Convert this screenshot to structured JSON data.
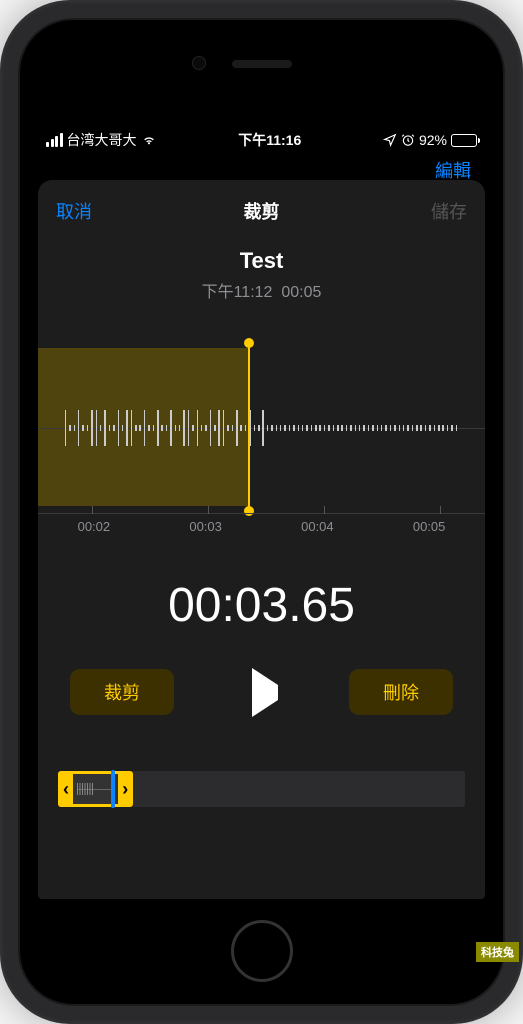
{
  "status_bar": {
    "carrier": "台湾大哥大",
    "time": "下午11:16",
    "battery_pct": "92%",
    "battery_fill_pct": 92,
    "location_icon": "location-icon",
    "alarm_icon": "alarm-icon"
  },
  "peek": {
    "edit_label": "編輯"
  },
  "nav": {
    "cancel": "取消",
    "title": "裁剪",
    "save": "儲存"
  },
  "recording": {
    "name": "Test",
    "timestamp": "下午11:12",
    "duration": "00:05"
  },
  "waveform": {
    "selection_start_pct": 0,
    "selection_end_pct": 47,
    "playhead_pct": 47,
    "axis_labels": [
      "00:02",
      "00:03",
      "00:04",
      "00:05"
    ]
  },
  "current_time": "00:03.65",
  "controls": {
    "trim_label": "裁剪",
    "delete_label": "刪除"
  },
  "mini_timeline": {
    "selection_width_pct": 18.5,
    "handle_left_glyph": "‹",
    "handle_right_glyph": "›",
    "playhead_left_pct": 13.5
  },
  "watermark": "科技兔",
  "colors": {
    "accent_yellow": "#ffcc00",
    "link_blue": "#0a84ff",
    "disabled_gray": "#555555"
  }
}
